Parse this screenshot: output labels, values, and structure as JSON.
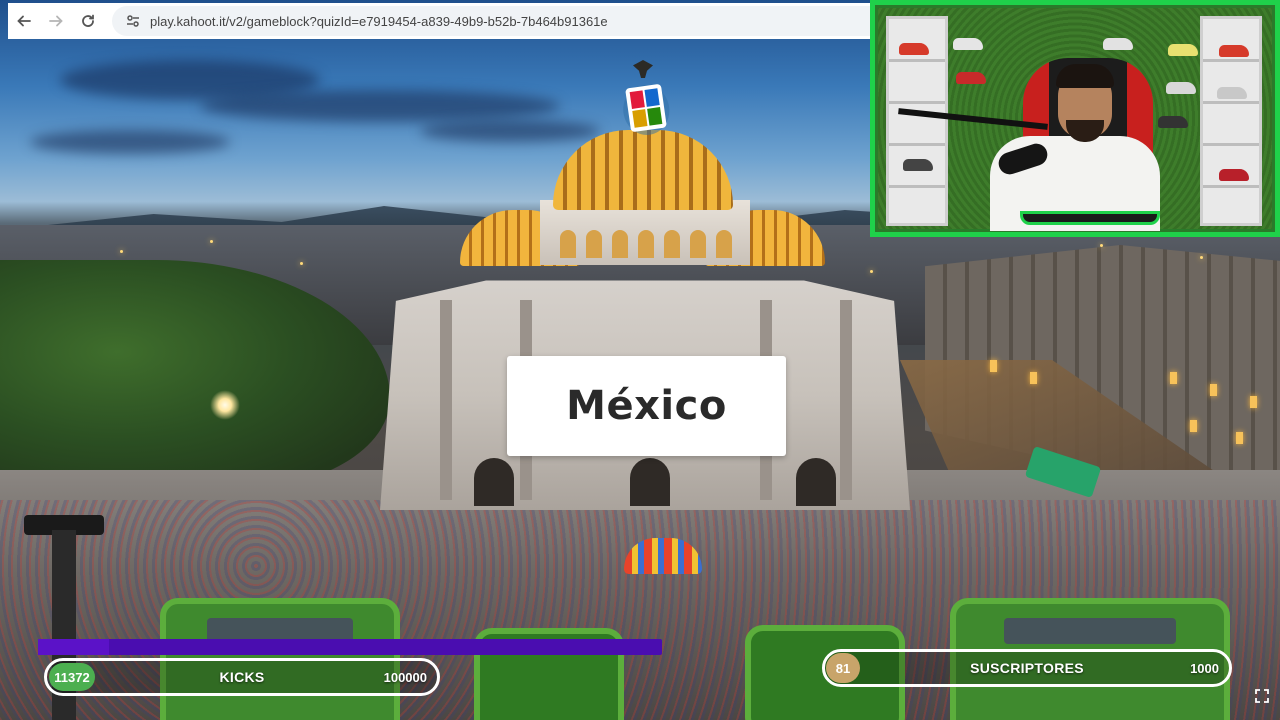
{
  "browser": {
    "url": "play.kahoot.it/v2/gameblock?quizId=e7919454-a839-49b9-b52b-7b464b91361e",
    "back_icon": "arrow-left",
    "forward_icon": "arrow-right",
    "reload_icon": "reload",
    "site_info_icon": "tune"
  },
  "question": {
    "answer": "México"
  },
  "overlay": {
    "kicks": {
      "current": "11372",
      "label": "KICKS",
      "goal": "100000",
      "progress": 0.114,
      "color": "#4caf50"
    },
    "subscribers": {
      "current": "81",
      "label": "SUSCRIPTORES",
      "goal": "1000",
      "progress": 0.081,
      "color": "#c8a46a"
    },
    "top_bar_color": "#4a0db0",
    "webcam_frame_color": "#1fd14a"
  },
  "controls": {
    "fullscreen_icon": "fullscreen"
  }
}
